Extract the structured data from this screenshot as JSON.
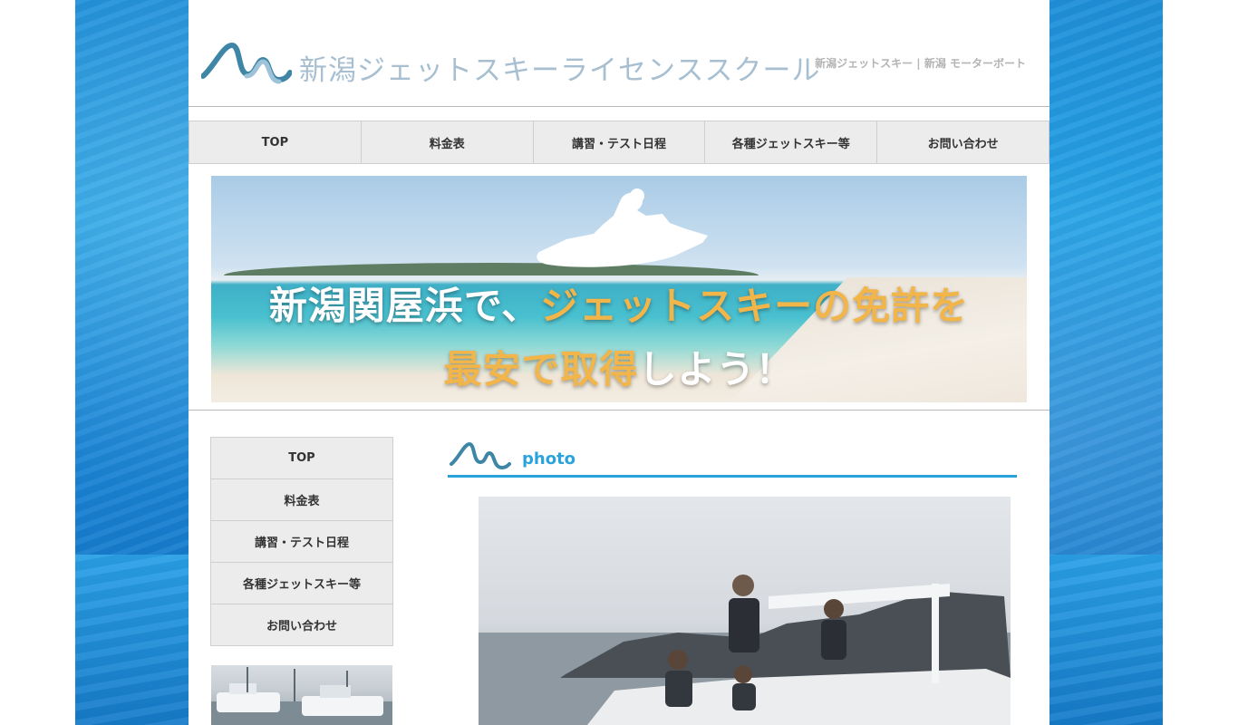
{
  "header": {
    "site_title": "新潟ジェットスキーライセンススクール",
    "tagline": "新潟ジェットスキー | 新潟 モーターボート"
  },
  "top_nav": [
    {
      "label": "TOP"
    },
    {
      "label": "料金表"
    },
    {
      "label": "講習・テスト日程"
    },
    {
      "label": "各種ジェットスキー等"
    },
    {
      "label": "お問い合わせ"
    }
  ],
  "hero": {
    "line1_white": "新潟関屋浜で、",
    "line1_orange": "ジェットスキーの免許を",
    "line2_orange": "最安で取得",
    "line2_white": "しよう！"
  },
  "side_nav": [
    {
      "label": "TOP"
    },
    {
      "label": "料金表"
    },
    {
      "label": "講習・テスト日程"
    },
    {
      "label": "各種ジェットスキー等"
    },
    {
      "label": "お問い合わせ"
    }
  ],
  "content": {
    "section_title": "photo"
  },
  "colors": {
    "accent": "#2aa3dd",
    "hero_highlight": "#f2b54a",
    "nav_bg": "#ececec"
  }
}
